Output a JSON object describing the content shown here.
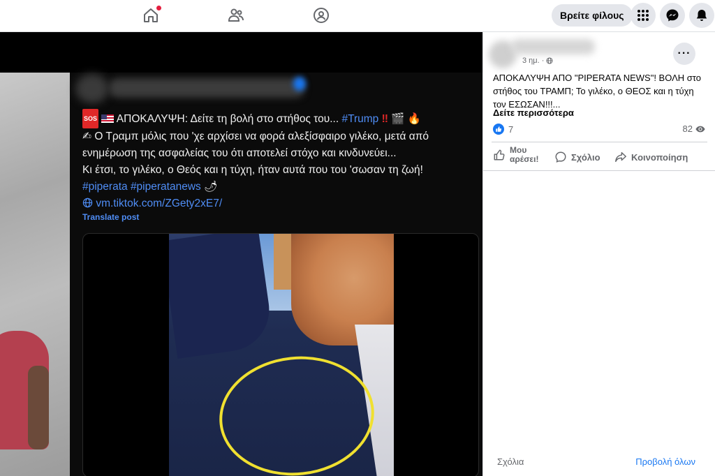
{
  "topbar": {
    "find_friends": "Βρείτε φίλους"
  },
  "post": {
    "text_line1_pre": "ΑΠΟΚΑΛΥΨΗ: Δείτε τη βολή στο στήθος του...",
    "text_line1_hashtag": "#Trump",
    "text_line2": "Ο Τραμπ μόλις που 'χε αρχίσει να φορά αλεξίσφαιρο γιλέκο, μετά από",
    "text_line3": "ενημέρωση της ασφαλείας του ότι αποτελεί στόχο και κινδυνεύει...",
    "text_line4": "Κι έτσι, το γιλέκο, ο Θεός και η τύχη, ήταν αυτά που του 'σωσαν τη ζωή!",
    "hashtags": "#piperata #piperatanews",
    "link": "vm.tiktok.com/ZGety2xE7/",
    "translate": "Translate post",
    "sos_label": "SOS"
  },
  "panel": {
    "time": "3 ημ. ·",
    "text": "ΑΠΟΚΑΛΥΨΗ ΑΠΟ \"PIPERATA NEWS\"! ΒΟΛΗ στο στήθος του ΤΡΑΜΠ; Το γιλέκο, ο ΘΕΟΣ και η τύχη τον ΕΣΩΣΑΝ!!!...",
    "see_more": "Δείτε περισσότερα",
    "likes": "7",
    "views": "82",
    "like_label": "Μου αρέσει!",
    "comment_label": "Σχόλιο",
    "share_label": "Κοινοποίηση",
    "comments_label": "Σχόλια",
    "view_all_label": "Προβολή όλων"
  },
  "icons": {
    "home": "home-icon",
    "friends": "friends-icon",
    "groups": "groups-icon",
    "menu": "grid-menu-icon",
    "messenger": "messenger-icon",
    "notifications": "bell-icon",
    "more": "more-icon",
    "globe": "globe-icon",
    "like": "like-icon",
    "comment": "comment-icon",
    "share": "share-icon",
    "eye": "eye-icon"
  },
  "colors": {
    "accent": "#1877f2",
    "hashtag": "#4f8df5",
    "circle_mark": "#f0e030"
  }
}
